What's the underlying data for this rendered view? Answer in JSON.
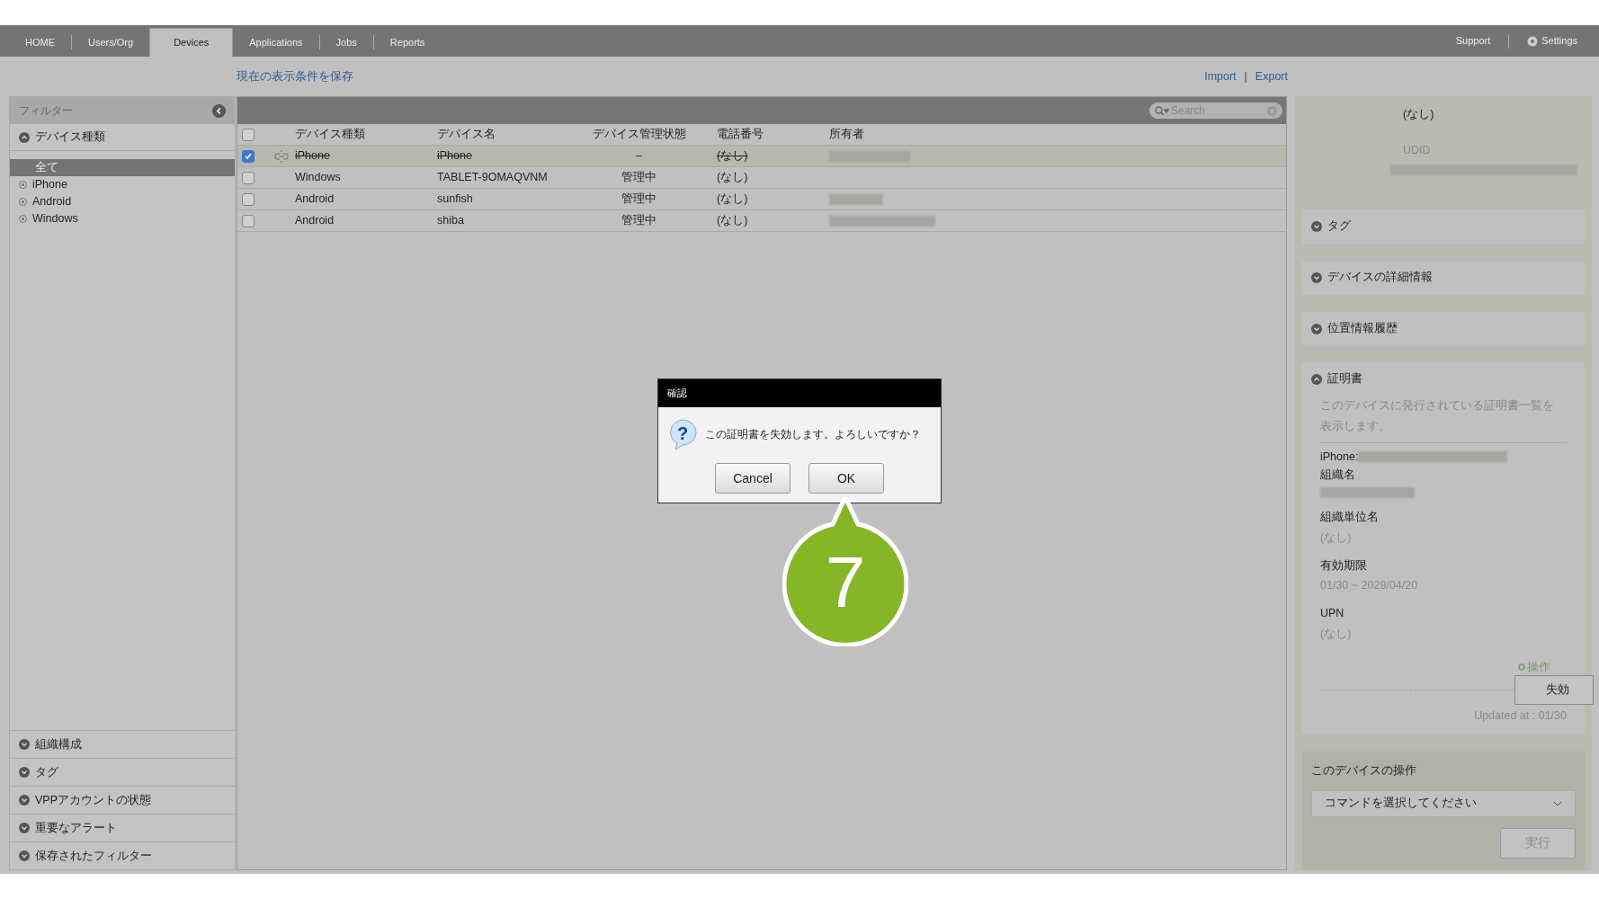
{
  "nav": {
    "tabs": [
      {
        "label": "HOME",
        "selected": false
      },
      {
        "label": "Users/Org",
        "selected": false
      },
      {
        "label": "Devices",
        "selected": true
      },
      {
        "label": "Applications",
        "selected": false
      },
      {
        "label": "Jobs",
        "selected": false
      },
      {
        "label": "Reports",
        "selected": false
      }
    ],
    "right": [
      "Support",
      "Settings"
    ]
  },
  "toolbar": {
    "save_view": "現在の表示条件を保存",
    "import": "Import",
    "separator": "|",
    "export": "Export"
  },
  "sidebar": {
    "title": "フィルター",
    "group": {
      "label": "デバイス種類",
      "expanded": true,
      "items": [
        {
          "label": "全て",
          "selected": true
        },
        {
          "label": "iPhone",
          "selected": false
        },
        {
          "label": "Android",
          "selected": false
        },
        {
          "label": "Windows",
          "selected": false
        }
      ]
    },
    "sections": [
      {
        "label": "組織構成",
        "expanded": false
      },
      {
        "label": "タグ",
        "expanded": false
      },
      {
        "label": "VPPアカウントの状態",
        "expanded": false
      },
      {
        "label": "重要なアラート",
        "expanded": false
      },
      {
        "label": "保存されたフィルター",
        "expanded": false
      }
    ]
  },
  "table": {
    "select_all_checked": false,
    "search": {
      "placeholder": "Search"
    },
    "columns": [
      "デバイス種類",
      "デバイス名",
      "デバイス管理状態",
      "電話番号",
      "所有者"
    ],
    "rows": [
      {
        "checked": true,
        "revoked": true,
        "type": "iPhone",
        "name": "iPhone",
        "status": "–",
        "phone": "(なし)",
        "owner_redacted": true
      },
      {
        "checked": false,
        "revoked": false,
        "type": "Windows",
        "name": "TABLET-9OMAQVNM",
        "status": "管理中",
        "phone": "(なし)",
        "owner_redacted": false
      },
      {
        "checked": false,
        "revoked": false,
        "type": "Android",
        "name": "sunfish",
        "status": "管理中",
        "phone": "(なし)",
        "owner_redacted": true
      },
      {
        "checked": false,
        "revoked": false,
        "type": "Android",
        "name": "shiba",
        "status": "管理中",
        "phone": "(なし)",
        "owner_redacted": true
      }
    ]
  },
  "detail": {
    "phone_value": "(なし)",
    "udid_label": "UDID",
    "sections": [
      {
        "label": "タグ",
        "expanded": false
      },
      {
        "label": "デバイスの詳細情報",
        "expanded": false
      },
      {
        "label": "位置情報履歴",
        "expanded": false
      }
    ],
    "certificate": {
      "label": "証明書",
      "expanded": true,
      "description": "このデバイスに発行されている証明書一覧を表示します。",
      "subject_label": "iPhone:",
      "fields": [
        {
          "label": "組織名",
          "redacted": true
        },
        {
          "label": "組織単位名",
          "value": "(なし)"
        },
        {
          "label": "有効期限",
          "value": "01/30 ~ 2029/04/20"
        },
        {
          "label": "UPN",
          "value": "(なし)"
        }
      ],
      "actions_label": "操作",
      "menu_item": "失効",
      "updated": "Updated at : 01/30"
    },
    "device_ops": {
      "title": "このデバイスの操作",
      "select_placeholder": "コマンドを選択してください",
      "run": "実行"
    }
  },
  "dialog": {
    "title": "確認",
    "icon": "?",
    "message": "この証明書を失効します。よろしいですか？",
    "buttons": [
      "Cancel",
      "OK"
    ]
  },
  "callout": {
    "label": "7"
  }
}
